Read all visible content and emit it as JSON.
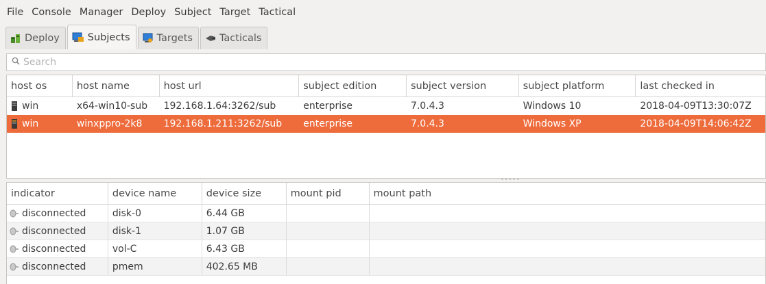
{
  "menubar": {
    "items": [
      "File",
      "Console",
      "Manager",
      "Deploy",
      "Subject",
      "Target",
      "Tactical"
    ]
  },
  "tabs": [
    {
      "label": "Deploy",
      "icon": "deploy-icon",
      "active": false
    },
    {
      "label": "Subjects",
      "icon": "subjects-icon",
      "active": true
    },
    {
      "label": "Targets",
      "icon": "targets-icon",
      "active": false
    },
    {
      "label": "Tacticals",
      "icon": "tacticals-icon",
      "active": false
    }
  ],
  "search": {
    "placeholder": "Search",
    "value": ""
  },
  "subjects_table": {
    "columns": [
      "host os",
      "host name",
      "host url",
      "subject edition",
      "subject version",
      "subject platform",
      "last checked in"
    ],
    "rows": [
      {
        "host_os": "win",
        "host_name": "x64-win10-sub",
        "host_url": "192.168.1.64:3262/sub",
        "edition": "enterprise",
        "version": "7.0.4.3",
        "platform": "Windows 10",
        "last_checked": "2018-04-09T13:30:07Z",
        "selected": false
      },
      {
        "host_os": "win",
        "host_name": "winxppro-2k8",
        "host_url": "192.168.1.211:3262/sub",
        "edition": "enterprise",
        "version": "7.0.4.3",
        "platform": "Windows XP",
        "last_checked": "2018-04-09T14:06:42Z",
        "selected": true
      }
    ]
  },
  "devices_table": {
    "columns": [
      "indicator",
      "device name",
      "device size",
      "mount pid",
      "mount path"
    ],
    "rows": [
      {
        "indicator": "disconnected",
        "device_name": "disk-0",
        "device_size": "6.44 GB",
        "mount_pid": "",
        "mount_path": ""
      },
      {
        "indicator": "disconnected",
        "device_name": "disk-1",
        "device_size": "1.07 GB",
        "mount_pid": "",
        "mount_path": ""
      },
      {
        "indicator": "disconnected",
        "device_name": "vol-C",
        "device_size": "6.43 GB",
        "mount_pid": "",
        "mount_path": ""
      },
      {
        "indicator": "disconnected",
        "device_name": "pmem",
        "device_size": "402.65 MB",
        "mount_pid": "",
        "mount_path": ""
      }
    ]
  },
  "colors": {
    "selection": "#ee6b3b",
    "window_bg": "#f2f1f0"
  }
}
